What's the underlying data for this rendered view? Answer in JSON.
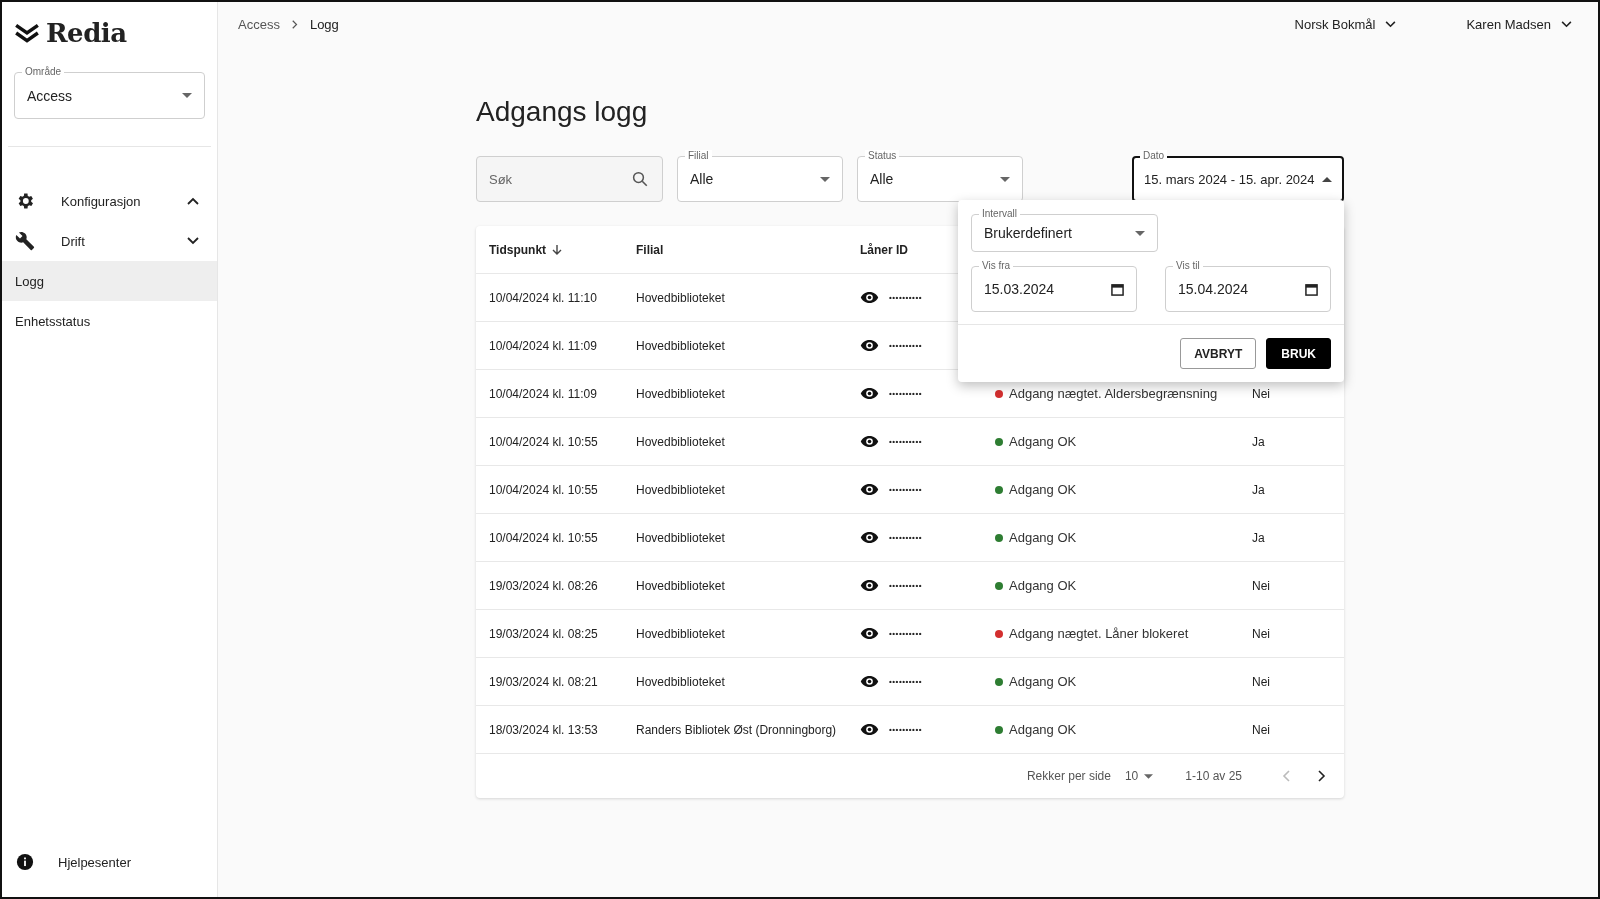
{
  "sidebar": {
    "logo": "Redia",
    "area_select": {
      "label": "Område",
      "value": "Access"
    },
    "nav": [
      {
        "kind": "group",
        "label": "Konfigurasjon",
        "expanded": true
      },
      {
        "kind": "group",
        "label": "Drift",
        "expanded": false
      },
      {
        "kind": "link",
        "label": "Logg",
        "selected": true
      },
      {
        "kind": "link",
        "label": "Enhetsstatus",
        "selected": false
      }
    ],
    "help": "Hjelpesenter"
  },
  "breadcrumbs": [
    "Access",
    "Logg"
  ],
  "header": {
    "language": "Norsk Bokmål",
    "user": "Karen Madsen"
  },
  "page_title": "Adgangs logg",
  "filters": {
    "search": {
      "placeholder": "Søk"
    },
    "selects": [
      {
        "label": "Filial",
        "value": "Alle"
      },
      {
        "label": "Status",
        "value": "Alle"
      }
    ],
    "date": {
      "label": "Dato",
      "value": "15. mars 2024 - 15. apr. 2024",
      "expanded": true
    }
  },
  "date_popover": {
    "interval": {
      "label": "Intervall",
      "value": "Brukerdefinert"
    },
    "from": {
      "label": "Vis fra",
      "value": "15.03.2024"
    },
    "to": {
      "label": "Vis til",
      "value": "15.04.2024"
    },
    "buttons": [
      {
        "kind": "outlined",
        "label": "AVBRYT"
      },
      {
        "kind": "filled",
        "label": "BRUK"
      }
    ]
  },
  "table": {
    "columns": [
      {
        "label": "Tidspunkt",
        "sorted": true
      },
      {
        "label": "Filial",
        "sorted": false
      },
      {
        "label": "Låner ID",
        "sorted": false
      }
    ],
    "rows": [
      {
        "time": "10/04/2024 kl. 11:10",
        "branch": "Hovedbiblioteket",
        "borrower": "••••••••••"
      },
      {
        "time": "10/04/2024 kl. 11:09",
        "branch": "Hovedbiblioteket",
        "borrower": "••••••••••"
      },
      {
        "time": "10/04/2024 kl. 11:09",
        "branch": "Hovedbiblioteket",
        "borrower": "••••••••••",
        "status": "Adgang nægtet. Aldersbegrænsning",
        "color": "#d32f2f",
        "column_5": "Nei"
      },
      {
        "time": "10/04/2024 kl. 10:55",
        "branch": "Hovedbiblioteket",
        "borrower": "••••••••••",
        "status": "Adgang OK",
        "color": "#2e7d32",
        "column_5": "Ja"
      },
      {
        "time": "10/04/2024 kl. 10:55",
        "branch": "Hovedbiblioteket",
        "borrower": "••••••••••",
        "status": "Adgang OK",
        "color": "#2e7d32",
        "column_5": "Ja"
      },
      {
        "time": "10/04/2024 kl. 10:55",
        "branch": "Hovedbiblioteket",
        "borrower": "••••••••••",
        "status": "Adgang OK",
        "color": "#2e7d32",
        "column_5": "Ja"
      },
      {
        "time": "19/03/2024 kl. 08:26",
        "branch": "Hovedbiblioteket",
        "borrower": "••••••••••",
        "status": "Adgang OK",
        "color": "#2e7d32",
        "column_5": "Nei"
      },
      {
        "time": "19/03/2024 kl. 08:25",
        "branch": "Hovedbiblioteket",
        "borrower": "••••••••••",
        "status": "Adgang nægtet. Låner blokeret",
        "color": "#d32f2f",
        "column_5": "Nei"
      },
      {
        "time": "19/03/2024 kl. 08:21",
        "branch": "Hovedbiblioteket",
        "borrower": "••••••••••",
        "status": "Adgang OK",
        "color": "#2e7d32",
        "column_5": "Nei"
      },
      {
        "time": "18/03/2024 kl. 13:53",
        "branch": "Randers Bibliotek Øst (Dronningborg)",
        "borrower": "••••••••••",
        "status": "Adgang OK",
        "color": "#2e7d32",
        "column_5": "Nei"
      }
    ],
    "pagination": {
      "rows_per_page_label": "Rekker per side",
      "rows_per_page": "10",
      "range": "1-10 av 25",
      "prev_disabled": true,
      "next_disabled": false
    }
  }
}
